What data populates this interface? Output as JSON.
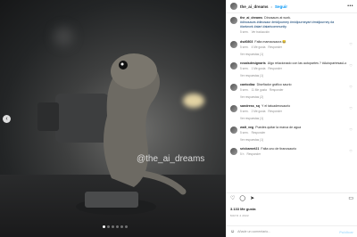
{
  "post": {
    "username": "the_ai_dreams",
    "follow_label": "Seguir",
    "more_icon": "more-horizontal-icon",
    "watermark": "@the_ai_dreams",
    "caption_user": "the_ai_dreams",
    "caption_text": "Dinosaurs at work.",
    "caption_tags": "#dinosaurs #dinosaur #midjourney #midjourneyart #midjourney #a #iartwork #aiart #aiartcommunity",
    "caption_time": "5 sem.",
    "caption_translate": "Ver traducción",
    "likes": "3.133 Me gusta",
    "date": "MAYO 2 2022",
    "add_comment_placeholder": "Añade un comentario...",
    "publish_label": "Publicar",
    "carousel_dots": 6,
    "carousel_active": 0
  },
  "comments": [
    {
      "user": "dsd0803",
      "text": "Falta mamaosaura 😂",
      "time": "5 sem.",
      "likes": "4 Me gusta",
      "reply": "Responder",
      "replies": "Ver respuestas (1)"
    },
    {
      "user": "rosalsdesignarts",
      "text": "Algo relacionado con las autopartes ? #AutopartesauLo",
      "time": "5 sem.",
      "likes": "1 Me gusta",
      "reply": "Responder",
      "replies": "Ver respuestas (1)"
    },
    {
      "user": "cantodiaz",
      "text": "Diseñador gráfico saurio",
      "time": "5 sem.",
      "likes": "11 Me gusta",
      "reply": "Responder",
      "replies": "Ver respuestas (2)"
    },
    {
      "user": "sandress_sq",
      "text": "Y el tatuaderosaurio",
      "time": "5 sem.",
      "likes": "2 Me gusta",
      "reply": "Responder",
      "replies": "Ver respuestas (1)"
    },
    {
      "user": "walt_veg",
      "text": "Puedes quitar la marca de agua",
      "time": "5 sem.",
      "likes": "Responder",
      "reply": "",
      "replies": "Ver respuestas (1)"
    },
    {
      "user": "sricbarnet21",
      "text": "Falta uno de tiranosaurio",
      "time": "5 h",
      "likes": "Responder",
      "reply": "",
      "replies": ""
    }
  ],
  "colors": {
    "link": "#0095f6",
    "muted": "#8e8e8e",
    "text": "#262626"
  }
}
